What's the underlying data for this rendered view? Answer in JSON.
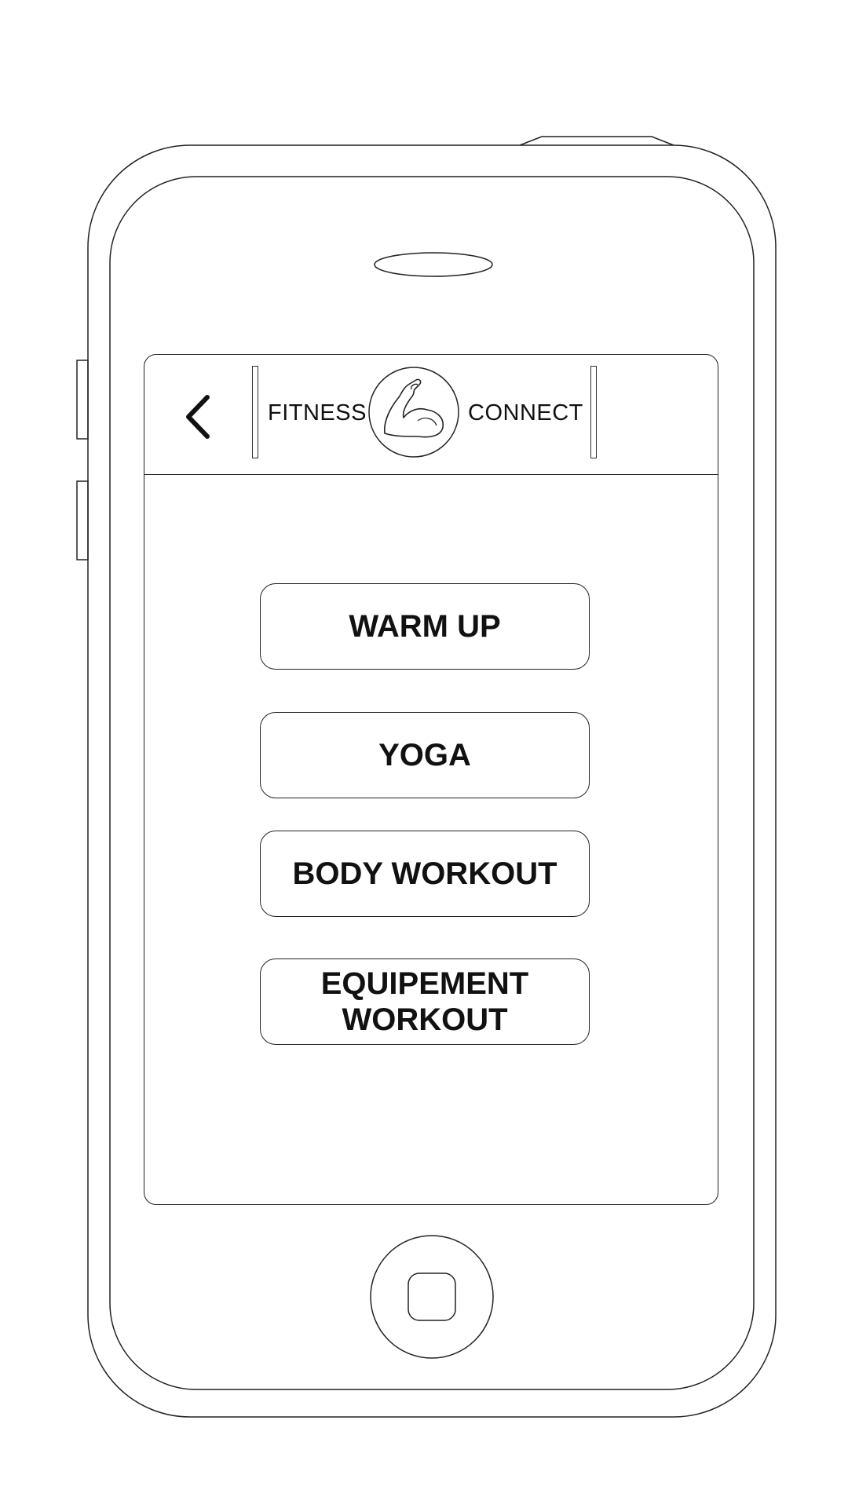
{
  "header": {
    "brand_left": "FITNESS",
    "brand_right": "CONNECT",
    "back_icon": "chevron-left-icon",
    "logo_icon": "flexed-bicep-icon"
  },
  "menu": {
    "items": [
      {
        "label": "WARM UP"
      },
      {
        "label": "YOGA"
      },
      {
        "label": "BODY WORKOUT"
      },
      {
        "label_line1": "EQUIPEMENT",
        "label_line2": "WORKOUT"
      }
    ]
  },
  "device": {
    "home_button_icon": "home-button-icon",
    "speaker_icon": "speaker-grille-icon"
  }
}
